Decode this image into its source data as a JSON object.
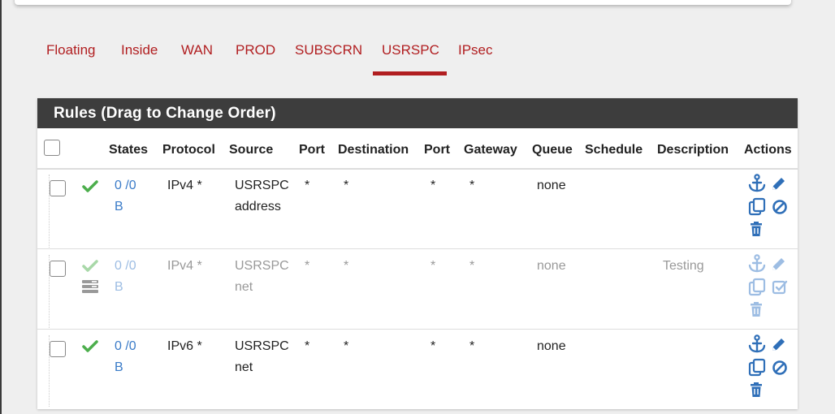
{
  "tabs": [
    {
      "label": "Floating"
    },
    {
      "label": "Inside"
    },
    {
      "label": "WAN"
    },
    {
      "label": "PROD"
    },
    {
      "label": "SUBSCRN"
    },
    {
      "label": "USRSPC"
    },
    {
      "label": "IPsec"
    }
  ],
  "active_tab": "USRSPC",
  "panel": {
    "title": "Rules (Drag to Change Order)"
  },
  "columns": {
    "states": "States",
    "protocol": "Protocol",
    "source": "Source",
    "port1": "Port",
    "destination": "Destination",
    "port2": "Port",
    "gateway": "Gateway",
    "queue": "Queue",
    "schedule": "Schedule",
    "description": "Description",
    "actions": "Actions"
  },
  "rules": [
    {
      "enabled": true,
      "states_line1": "0 /0",
      "states_line2": "B",
      "protocol": "IPv4 *",
      "source_line1": "USRSPC",
      "source_line2": "address",
      "port1": "*",
      "destination": "*",
      "port2": "*",
      "gateway": "*",
      "queue": "none",
      "schedule": "",
      "description": ""
    },
    {
      "enabled": false,
      "states_line1": "0 /0",
      "states_line2": "B",
      "protocol": "IPv4 *",
      "source_line1": "USRSPC",
      "source_line2": "net",
      "port1": "*",
      "destination": "*",
      "port2": "*",
      "gateway": "*",
      "queue": "none",
      "schedule": "",
      "description": "Testing"
    },
    {
      "enabled": true,
      "states_line1": "0 /0",
      "states_line2": "B",
      "protocol": "IPv6 *",
      "source_line1": "USRSPC",
      "source_line2": "net",
      "port1": "*",
      "destination": "*",
      "port2": "*",
      "gateway": "*",
      "queue": "none",
      "schedule": "",
      "description": ""
    }
  ],
  "colors": {
    "accent": "#b11e20",
    "heading_bg": "#3d3d3d",
    "link": "#3a7bc8",
    "check_green": "#4cae4c"
  },
  "icons": [
    "checkmark-icon",
    "anchor-icon",
    "pencil-icon",
    "copy-icon",
    "disable-icon",
    "enable-icon",
    "trash-icon",
    "disabled-rule-icon"
  ]
}
